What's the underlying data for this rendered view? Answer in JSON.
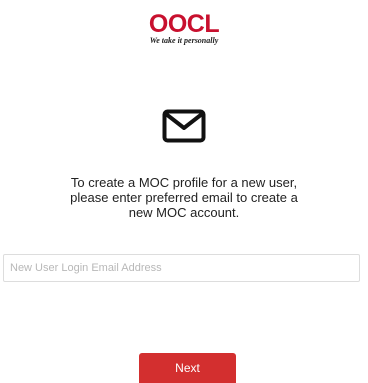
{
  "logo": {
    "brand": "OOCL",
    "tagline": "We take it personally"
  },
  "icons": {
    "mail": "envelope-icon"
  },
  "message": {
    "line1": "To create a MOC profile for a new user,",
    "line2": "please enter preferred email to create a",
    "line3": "new MOC account."
  },
  "email_field": {
    "placeholder": "New User Login Email Address",
    "value": ""
  },
  "next_button": {
    "label": "Next"
  },
  "colors": {
    "brand_red": "#c8102e",
    "button_red": "#d32f2f"
  }
}
